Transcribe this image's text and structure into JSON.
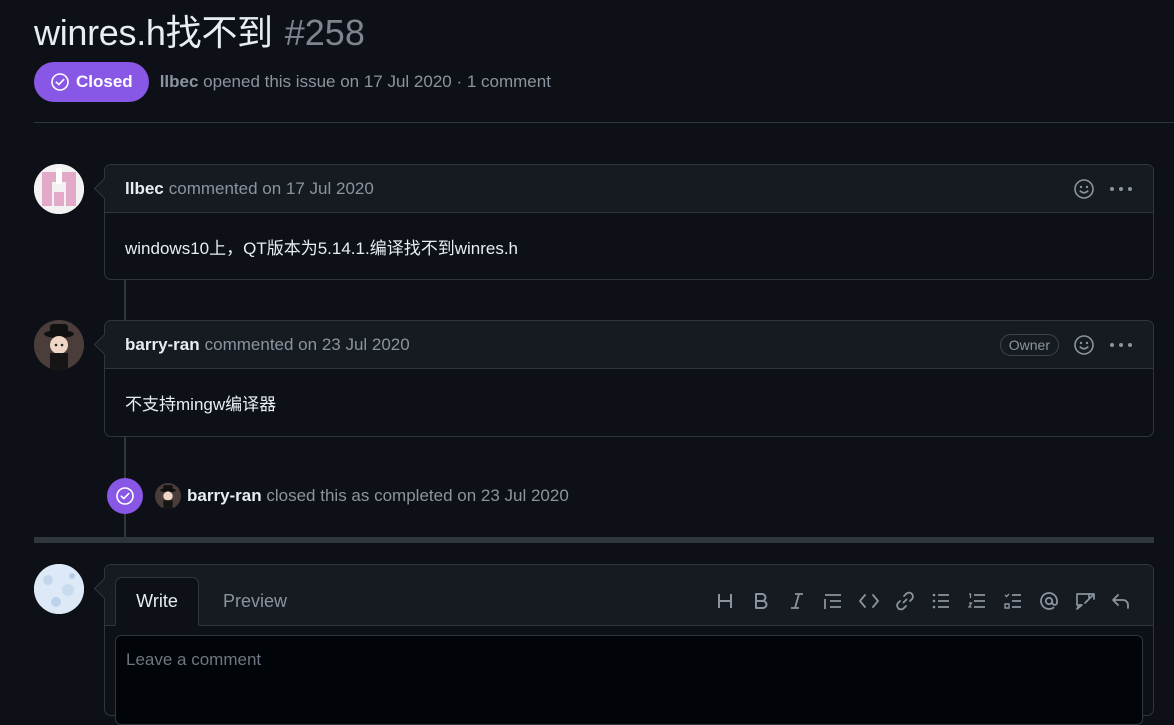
{
  "issue": {
    "title": "winres.h找不到",
    "number": "#258",
    "state": "Closed",
    "author": "llbec",
    "meta": "opened this issue on 17 Jul 2020 · 1 comment"
  },
  "comments": [
    {
      "author": "llbec",
      "timestamp": "commented on 17 Jul 2020",
      "body": "windows10上，QT版本为5.14.1.编译找不到winres.h",
      "badge": ""
    },
    {
      "author": "barry-ran",
      "timestamp": "commented on 23 Jul 2020",
      "body": "不支持mingw编译器",
      "badge": "Owner"
    }
  ],
  "event": {
    "actor": "barry-ran",
    "text": "closed this as completed on 23 Jul 2020"
  },
  "editor": {
    "tab_write": "Write",
    "tab_preview": "Preview",
    "placeholder": "Leave a comment",
    "toolbar": [
      "heading-icon",
      "bold-icon",
      "italic-icon",
      "quote-icon",
      "code-icon",
      "link-icon",
      "bullet-list-icon",
      "numbered-list-icon",
      "task-list-icon",
      "mention-icon",
      "reference-icon",
      "reply-icon"
    ]
  },
  "colors": {
    "closed_purple": "#8957e5",
    "background": "#0d1117",
    "border": "#30363d",
    "muted": "#8b949e"
  }
}
